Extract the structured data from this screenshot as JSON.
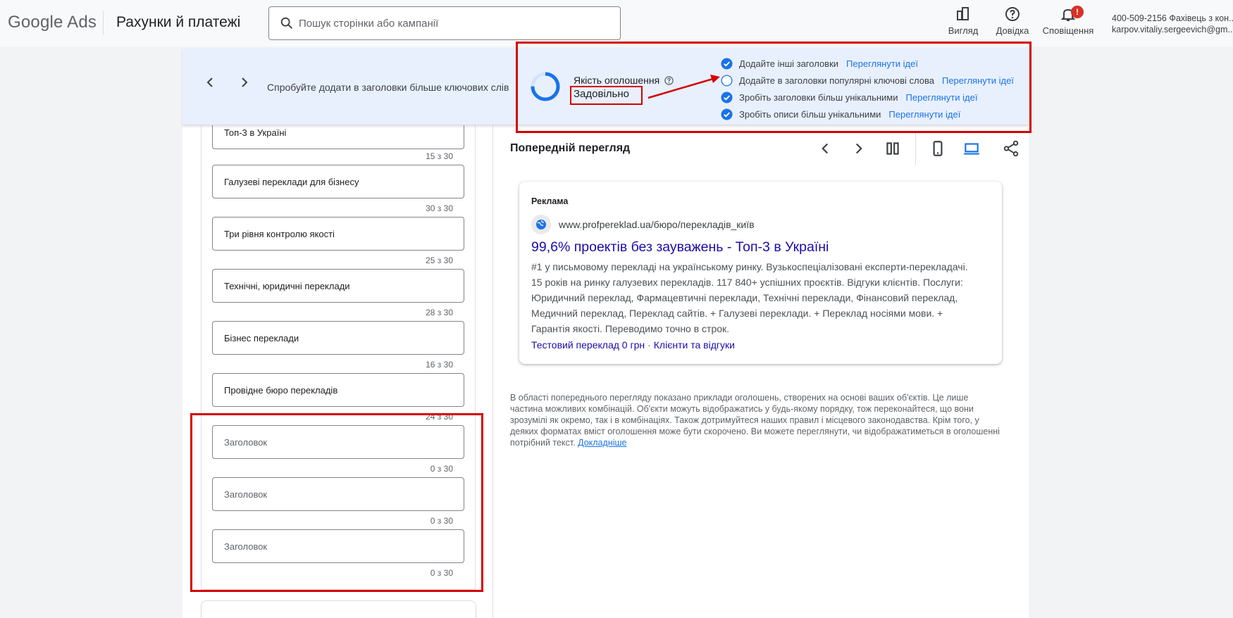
{
  "header": {
    "logo": "Google Ads",
    "page_title": "Рахунки й платежі",
    "search_placeholder": "Пошук сторінки або кампанії",
    "tools": {
      "view": "Вигляд",
      "help": "Довідка",
      "notifications": "Сповіщення",
      "notifications_badge": "!"
    },
    "account": {
      "line1": "400-509-2156 Фахівець з кон...",
      "line2": "karpov.vitaliy.sergeevich@gm..."
    }
  },
  "banner": {
    "message": "Спробуйте додати в заголовки більше ключових слів",
    "quality_label": "Якість оголошення",
    "quality_value": "Задовільно",
    "tips": [
      {
        "text": "Додайте інші заголовки",
        "link": "Переглянути ідеї",
        "done": true
      },
      {
        "text": "Додайте в заголовки популярні ключові слова",
        "link": "Переглянути ідеї",
        "done": false
      },
      {
        "text": "Зробіть заголовки більш унікальними",
        "link": "Переглянути ідеї",
        "done": true
      },
      {
        "text": "Зробіть описи більш унікальними",
        "link": "Переглянути ідеї",
        "done": true
      }
    ]
  },
  "headlines": [
    {
      "text": "Топ-3 в Україні",
      "count": "15 з 30"
    },
    {
      "text": "Галузеві переклади для бізнесу",
      "count": "30 з 30"
    },
    {
      "text": "Три рівня контролю якості",
      "count": "25 з 30"
    },
    {
      "text": "Технічні, юридичні переклади",
      "count": "28 з 30"
    },
    {
      "text": "Бізнес переклади",
      "count": "16 з 30"
    },
    {
      "text": "Провідне бюро перекладів",
      "count": "24 з 30"
    },
    {
      "text": "",
      "placeholder": "Заголовок",
      "count": "0 з 30"
    },
    {
      "text": "",
      "placeholder": "Заголовок",
      "count": "0 з 30"
    },
    {
      "text": "",
      "placeholder": "Заголовок",
      "count": "0 з 30"
    }
  ],
  "preview": {
    "title": "Попередній перегляд",
    "ad": {
      "label": "Реклама",
      "url": "www.profpereklad.ua/бюро/перекладів_київ",
      "headline": "99,6% проектів без зауважень - Топ-3 в Україні",
      "description": "#1 у письмовому перекладі на українському ринку. Вузькоспеціалізовані експерти-перекладачі. 15 років на ринку галузевих перекладів. 117 840+ успішних проєктів. Відгуки клієнтів. Послуги: Юридичний переклад, Фармацевтичні переклади, Технічні переклади, Фінансовий переклад, Медичний переклад, Переклад сайтів. + Галузеві переклади. + Переклад носіями мови. + Гарантія якості. Переводимо точно в строк.",
      "sitelink1": "Тестовий переклад 0 грн",
      "sitelink_sep": "·",
      "sitelink2": "Клієнти та відгуки"
    },
    "disclaimer": "В області попереднього перегляду показано приклади оголошень, створених на основі ваших об'єктів. Це лише частина можливих комбінацій. Об'єкти можуть відображатись у будь-якому порядку, тож переконайтеся, що вони зрозумілі як окремо, так і в комбінаціях. Також дотримуйтеся наших правил і місцевого законодавства. Крім того, у деяких форматах вміст оголошення може бути скорочено. Ви можете переглянути, чи відображатиметься в оголошенні потрібний текст.",
    "learn_more": "Докладніше"
  },
  "colors": {
    "accent": "#1a73e8",
    "annotation": "#d50000",
    "ad_link": "#1a0dab"
  }
}
